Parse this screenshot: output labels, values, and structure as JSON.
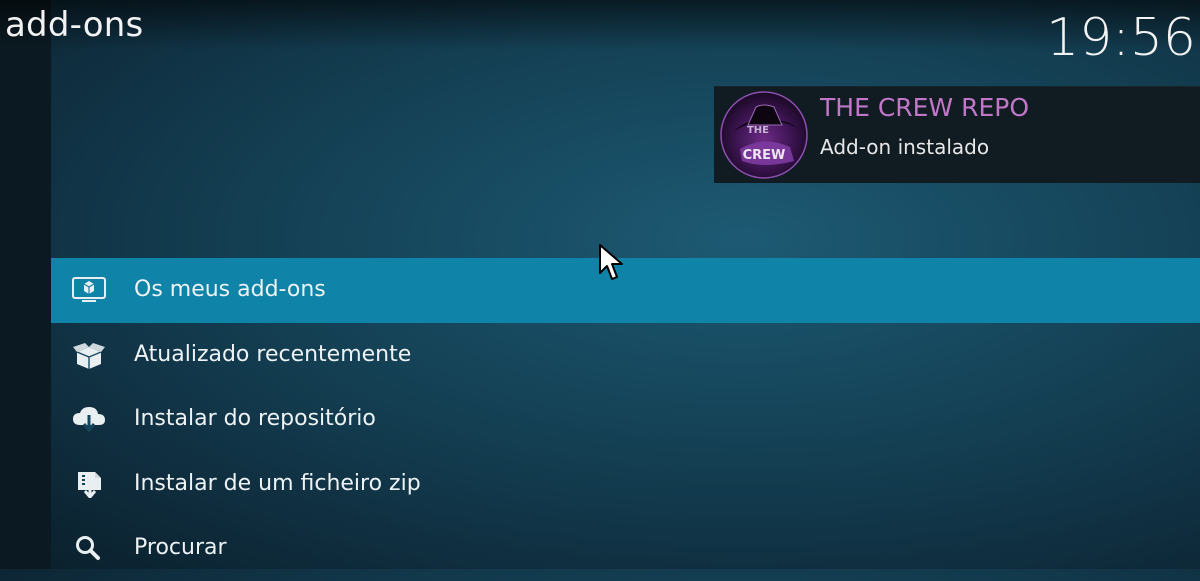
{
  "header": {
    "title": "add-ons",
    "time": "19:56"
  },
  "notification": {
    "title": "THE CREW REPO",
    "message": "Add-on instalado",
    "avatar_icon": "the-crew-logo",
    "logo_text": {
      "line1": "THE",
      "line2": "CREW"
    },
    "title_color": "#c276c8"
  },
  "menu": {
    "selected": "Os meus add-ons",
    "items": [
      {
        "label": "Os meus add-ons",
        "icon": "monitor-box-icon"
      },
      {
        "label": "Atualizado recentemente",
        "icon": "open-box-icon"
      },
      {
        "label": "Instalar do repositório",
        "icon": "cloud-download-icon"
      },
      {
        "label": "Instalar de um ficheiro zip",
        "icon": "zip-install-icon"
      },
      {
        "label": "Procurar",
        "icon": "search-icon"
      }
    ]
  },
  "colors": {
    "accent": "#0f84a8",
    "background": "#12384b"
  }
}
